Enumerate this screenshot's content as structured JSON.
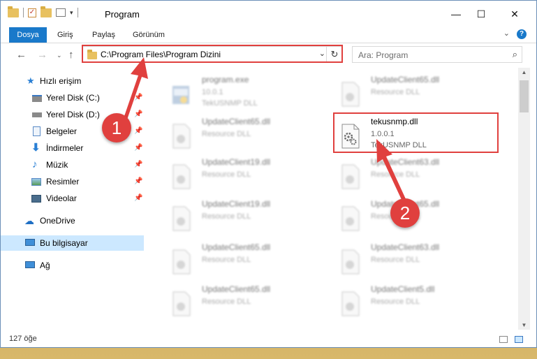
{
  "window": {
    "title": "Program",
    "controls": {
      "minimize": "—",
      "maximize": "☐",
      "close": "✕"
    }
  },
  "ribbon": {
    "tabs": [
      {
        "label": "Dosya"
      },
      {
        "label": "Giriş"
      },
      {
        "label": "Paylaş"
      },
      {
        "label": "Görünüm"
      }
    ],
    "help": "?"
  },
  "navigation": {
    "address": "C:\\Program Files\\Program Dizini",
    "search_placeholder": "Ara: Program"
  },
  "sidebar": {
    "items": [
      {
        "label": "Hızlı erişim",
        "icon": "star-icon",
        "pinned": false
      },
      {
        "label": "Yerel Disk (C:)",
        "icon": "drive-icon",
        "pinned": true
      },
      {
        "label": "Yerel Disk (D:)",
        "icon": "drive-icon",
        "pinned": true
      },
      {
        "label": "Belgeler",
        "icon": "documents-icon",
        "pinned": true
      },
      {
        "label": "İndirmeler",
        "icon": "download-icon",
        "pinned": true
      },
      {
        "label": "Müzik",
        "icon": "music-icon",
        "pinned": true
      },
      {
        "label": "Resimler",
        "icon": "pictures-icon",
        "pinned": true
      },
      {
        "label": "Videolar",
        "icon": "videos-icon",
        "pinned": true
      },
      {
        "label": "OneDrive",
        "icon": "cloud-icon",
        "pinned": false
      },
      {
        "label": "Bu bilgisayar",
        "icon": "computer-icon",
        "pinned": false,
        "selected": true
      },
      {
        "label": "Ağ",
        "icon": "network-icon",
        "pinned": false
      }
    ]
  },
  "files": [
    {
      "name": "program.exe",
      "version": "10.0.1",
      "description": "TekUSNMP DLL"
    },
    {
      "name": "UpdateClient65.dll",
      "version": "",
      "description": "Resource DLL"
    },
    {
      "name": "UpdateClient65.dll",
      "version": "",
      "description": "Resource DLL"
    },
    {
      "name": "tekusnmp.dll",
      "version": "1.0.0.1",
      "description": "TekUSNMP DLL",
      "highlighted": true
    },
    {
      "name": "UpdateClient19.dll",
      "version": "",
      "description": "Resource DLL"
    },
    {
      "name": "UpdateClient63.dll",
      "version": "",
      "description": "Resource DLL"
    },
    {
      "name": "UpdateClient19.dll",
      "version": "",
      "description": "Resource DLL"
    },
    {
      "name": "UpdateClient65.dll",
      "version": "",
      "description": "Resource DLL"
    },
    {
      "name": "UpdateClient65.dll",
      "version": "",
      "description": "Resource DLL"
    },
    {
      "name": "UpdateClient63.dll",
      "version": "",
      "description": "Resource DLL"
    },
    {
      "name": "UpdateClient65.dll",
      "version": "",
      "description": "Resource DLL"
    },
    {
      "name": "UpdateClient5.dll",
      "version": "",
      "description": "Resource DLL"
    }
  ],
  "status": {
    "item_count": "127 öğe"
  },
  "annotations": {
    "step1": "1",
    "step2": "2",
    "color": "#e0403e"
  }
}
